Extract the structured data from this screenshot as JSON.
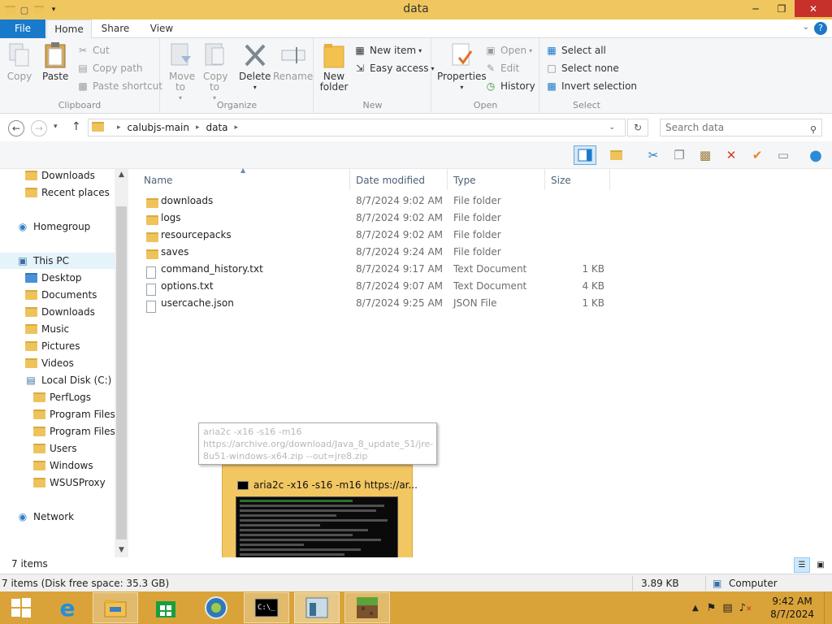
{
  "window": {
    "title": "data"
  },
  "ribbon_tabs": {
    "file": "File",
    "home": "Home",
    "share": "Share",
    "view": "View"
  },
  "ribbon": {
    "clipboard": {
      "label": "Clipboard",
      "copy": "Copy",
      "paste": "Paste",
      "cut": "Cut",
      "copy_path": "Copy path",
      "paste_shortcut": "Paste shortcut"
    },
    "organize": {
      "label": "Organize",
      "move_to": "Move to",
      "copy_to": "Copy to",
      "delete": "Delete",
      "rename": "Rename"
    },
    "new": {
      "label": "New",
      "new_folder": "New folder",
      "new_item": "New item",
      "easy_access": "Easy access"
    },
    "open": {
      "label": "Open",
      "properties": "Properties",
      "open": "Open",
      "edit": "Edit",
      "history": "History"
    },
    "select": {
      "label": "Select",
      "select_all": "Select all",
      "select_none": "Select none",
      "invert_selection": "Invert selection"
    }
  },
  "address": {
    "breadcrumb": [
      "calubjs-main",
      "data"
    ],
    "search_placeholder": "Search data"
  },
  "nav_pane": {
    "items": [
      {
        "label": "Downloads",
        "icon": "downloads-icon"
      },
      {
        "label": "Recent places",
        "icon": "recent-places-icon"
      },
      {
        "label": "Homegroup",
        "icon": "homegroup-icon"
      },
      {
        "label": "This PC",
        "icon": "computer-icon"
      },
      {
        "label": "Desktop",
        "icon": "desktop-icon"
      },
      {
        "label": "Documents",
        "icon": "documents-icon"
      },
      {
        "label": "Downloads",
        "icon": "downloads-icon"
      },
      {
        "label": "Music",
        "icon": "music-icon"
      },
      {
        "label": "Pictures",
        "icon": "pictures-icon"
      },
      {
        "label": "Videos",
        "icon": "videos-icon"
      },
      {
        "label": "Local Disk (C:)",
        "icon": "drive-icon"
      },
      {
        "label": "PerfLogs",
        "icon": "folder-icon"
      },
      {
        "label": "Program Files",
        "icon": "folder-icon"
      },
      {
        "label": "Program Files (",
        "icon": "folder-icon"
      },
      {
        "label": "Users",
        "icon": "folder-icon"
      },
      {
        "label": "Windows",
        "icon": "folder-icon"
      },
      {
        "label": "WSUSProxy",
        "icon": "folder-icon"
      },
      {
        "label": "Network",
        "icon": "network-icon"
      }
    ]
  },
  "file_list": {
    "columns": [
      "Name",
      "Date modified",
      "Type",
      "Size"
    ],
    "rows": [
      {
        "name": "downloads",
        "date": "8/7/2024 9:02 AM",
        "type": "File folder",
        "size": "",
        "icon": "folder-icon"
      },
      {
        "name": "logs",
        "date": "8/7/2024 9:02 AM",
        "type": "File folder",
        "size": "",
        "icon": "folder-icon"
      },
      {
        "name": "resourcepacks",
        "date": "8/7/2024 9:02 AM",
        "type": "File folder",
        "size": "",
        "icon": "folder-icon"
      },
      {
        "name": "saves",
        "date": "8/7/2024 9:24 AM",
        "type": "File folder",
        "size": "",
        "icon": "folder-icon"
      },
      {
        "name": "command_history.txt",
        "date": "8/7/2024 9:17 AM",
        "type": "Text Document",
        "size": "1 KB",
        "icon": "text-file-icon"
      },
      {
        "name": "options.txt",
        "date": "8/7/2024 9:07 AM",
        "type": "Text Document",
        "size": "4 KB",
        "icon": "text-file-icon"
      },
      {
        "name": "usercache.json",
        "date": "8/7/2024 9:25 AM",
        "type": "JSON File",
        "size": "1 KB",
        "icon": "text-file-icon"
      }
    ]
  },
  "tooltip": {
    "text": "aria2c  -x16 -s16 -m16 https://archive.org/download/Java_8_update_51/jre-8u51-windows-x64.zip --out=jre8.zip"
  },
  "thumbnail": {
    "title": "aria2c  -x16 -s16 -m16 https://ar..."
  },
  "status": {
    "item_count": "7 items",
    "disk": "7 items (Disk free space: 35.3 GB)",
    "size": "3.89 KB",
    "location": "Computer"
  },
  "clock": {
    "time": "9:42 AM",
    "date": "8/7/2024"
  },
  "colors": {
    "titlebar": "#f0c75e",
    "taskbar": "#d9a33a",
    "accent": "#1979ca",
    "close": "#c7302b"
  }
}
